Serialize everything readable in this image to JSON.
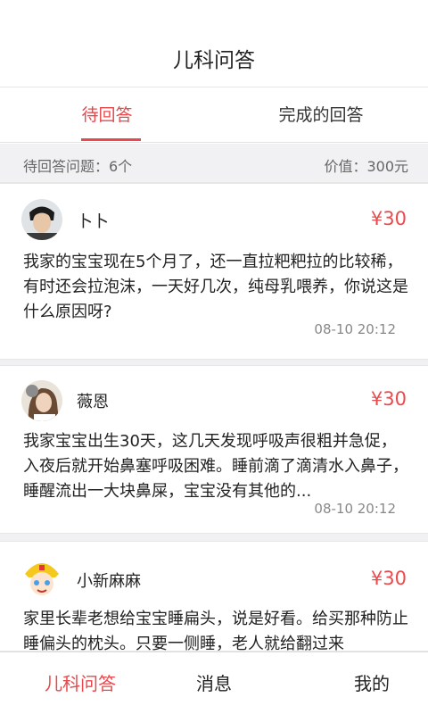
{
  "header": {
    "title": "儿科问答"
  },
  "tabs": [
    {
      "label": "待回答"
    },
    {
      "label": "完成的回答"
    }
  ],
  "summary": {
    "pending_label": "待回答问题：6个",
    "value_label": "价值：300元"
  },
  "questions": [
    {
      "user": "卜卜",
      "price": "¥30",
      "text": "我家的宝宝现在5个月了，还一直拉粑粑拉的比较稀，有时还会拉泡沫，一天好几次，纯母乳喂养，你说这是什么原因呀?",
      "time": "08-10 20:12"
    },
    {
      "user": "薇恩",
      "price": "¥30",
      "text": "我家宝宝出生30天，这几天发现呼吸声很粗并急促，入夜后就开始鼻塞呼吸困难。睡前滴了滴清水入鼻子，睡醒流出一大块鼻屎，宝宝没有其他的...",
      "time": "08-10 20:12"
    },
    {
      "user": "小新麻麻",
      "price": "¥30",
      "text": "家里长辈老想给宝宝睡扁头，说是好看。给买那种防止睡偏头的枕头。只要一侧睡，老人就给翻过来",
      "time": ""
    }
  ],
  "bottom_nav": [
    {
      "label": "儿科问答"
    },
    {
      "label": "消息"
    },
    {
      "label": "我的"
    }
  ],
  "colors": {
    "accent": "#e8484b",
    "price": "#ea4a4c",
    "background_gray": "#f1f1f3"
  }
}
